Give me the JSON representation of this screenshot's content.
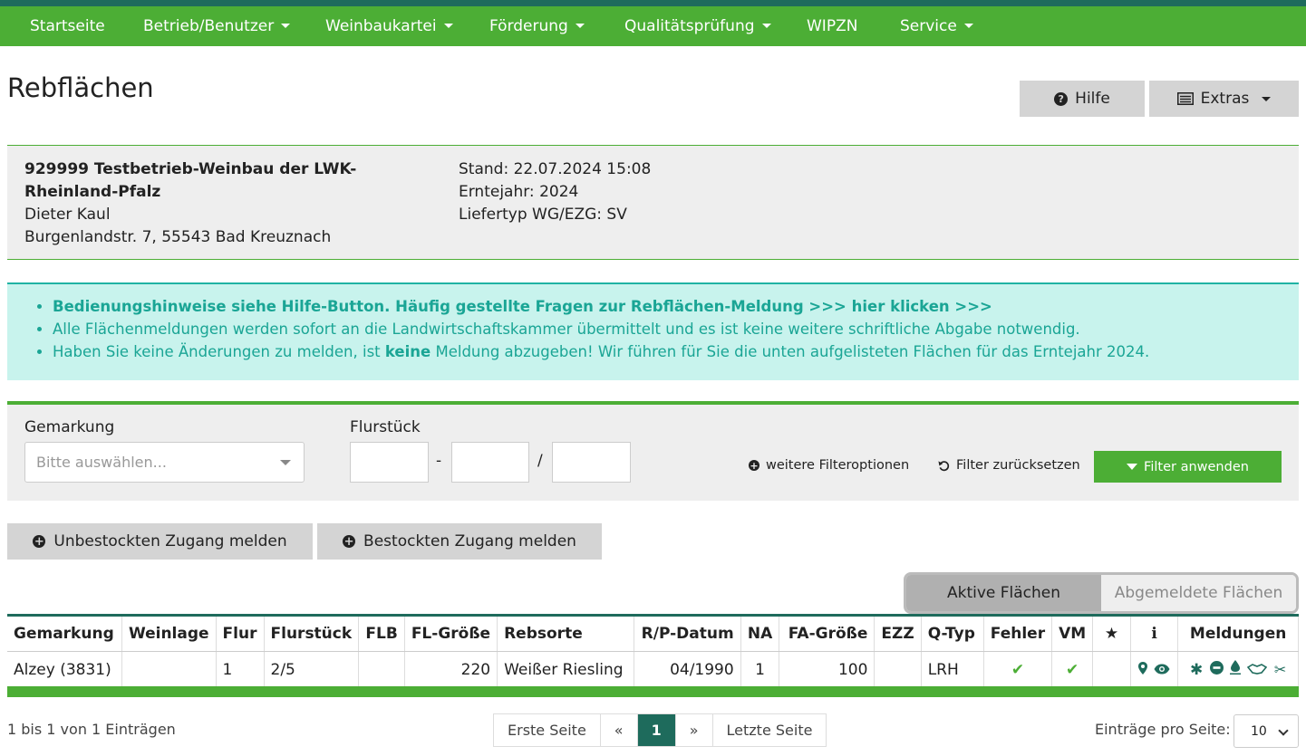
{
  "nav": {
    "items": [
      {
        "label": "Startseite",
        "dropdown": false
      },
      {
        "label": "Betrieb/Benutzer",
        "dropdown": true
      },
      {
        "label": "Weinbaukartei",
        "dropdown": true
      },
      {
        "label": "Förderung",
        "dropdown": true
      },
      {
        "label": "Qualitätsprüfung",
        "dropdown": true
      },
      {
        "label": "WIPZN",
        "dropdown": false
      },
      {
        "label": "Service",
        "dropdown": true
      }
    ]
  },
  "page": {
    "title": "Rebflächen",
    "help_label": "Hilfe",
    "extras_label": "Extras"
  },
  "company": {
    "name": "929999 Testbetrieb-Weinbau der LWK-Rheinland-Pfalz",
    "contact": "Dieter Kaul",
    "address": "Burgenlandstr. 7, 55543 Bad Kreuznach",
    "stand": "Stand: 22.07.2024 15:08",
    "erntejahr": "Erntejahr: 2024",
    "liefertyp": "Liefertyp WG/EZG: SV"
  },
  "notice": {
    "line1": "Bedienungshinweise siehe Hilfe-Button. Häufig gestellte Fragen zur Rebflächen-Meldung >>> hier klicken >>>",
    "line2": "Alle Flächenmeldungen werden sofort an die Landwirtschaftskammer übermittelt und es ist keine weitere schriftliche Abgabe notwendig.",
    "line3_pre": "Haben Sie keine Änderungen zu melden, ist ",
    "line3_bold": "keine",
    "line3_post": " Meldung abzugeben! Wir führen für Sie die unten aufgelisteten Flächen für das Erntejahr 2024."
  },
  "filter": {
    "gemarkung_label": "Gemarkung",
    "gemarkung_placeholder": "Bitte auswählen...",
    "flurstueck_label": "Flurstück",
    "sep_dash": "-",
    "sep_slash": "/",
    "more_options": "weitere Filteroptionen",
    "reset": "Filter zurücksetzen",
    "apply": "Filter anwenden"
  },
  "actions": {
    "unbestockt": "Unbestockten Zugang melden",
    "bestockt": "Bestockten Zugang melden"
  },
  "toggle": {
    "active": "Aktive Flächen",
    "inactive": "Abgemeldete Flächen"
  },
  "table": {
    "headers": [
      "Gemarkung",
      "Weinlage",
      "Flur",
      "Flurstück",
      "FLB",
      "FL-Größe",
      "Rebsorte",
      "R/P-Datum",
      "NA",
      "FA-Größe",
      "EZZ",
      "Q-Typ",
      "Fehler",
      "VM",
      "★",
      "ℹ",
      "Meldungen"
    ],
    "rows": [
      {
        "gemarkung": "Alzey (3831)",
        "weinlage": "",
        "flur": "1",
        "flurstueck": "2/5",
        "flb": "",
        "fl_groesse": "220",
        "rebsorte": "Weißer Riesling",
        "rp_datum": "04/1990",
        "na": "1",
        "fa_groesse": "100",
        "ezz": "",
        "q_typ": "LRH",
        "fehler": "✔",
        "vm": "✔"
      }
    ]
  },
  "pagination": {
    "summary": "1 bis 1 von 1 Einträgen",
    "first": "Erste Seite",
    "prev": "«",
    "current": "1",
    "next": "»",
    "last": "Letzte Seite",
    "per_page_label": "Einträge pro Seite:",
    "per_page_value": "10"
  },
  "colors": {
    "nav_green": "#4cae35",
    "dark_teal": "#1e6b5c",
    "notice_bg": "#c8f3ed",
    "notice_text": "#1aa595"
  }
}
